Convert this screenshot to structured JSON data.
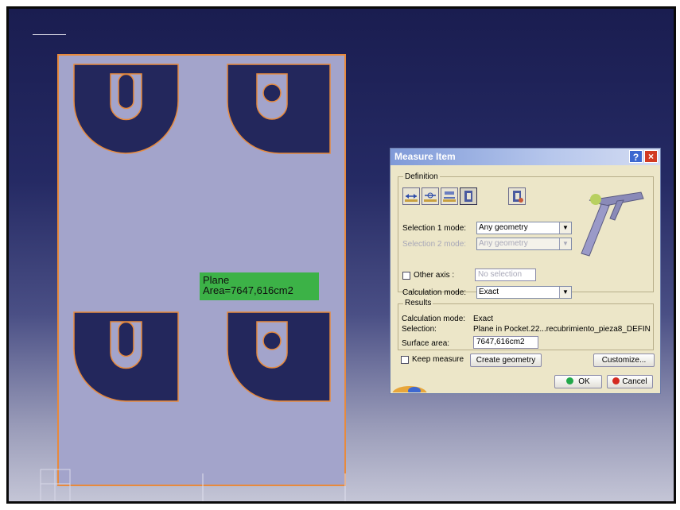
{
  "viewport": {
    "tooltip": {
      "line1": "Plane",
      "line2": "Area=7647,616cm2"
    }
  },
  "dialog": {
    "title": "Measure Item",
    "help_label": "?",
    "close_label": "×",
    "definition": {
      "group_label": "Definition",
      "tools": [
        "measure-between-icon",
        "measure-item-icon",
        "measure-thickness-icon",
        "measure-item-active-icon",
        "measure-inertia-icon"
      ],
      "selection1_label": "Selection 1 mode:",
      "selection1_value": "Any geometry",
      "selection2_label": "Selection 2 mode:",
      "selection2_value": "Any geometry",
      "other_axis_label": "Other axis :",
      "other_axis_value": "No selection",
      "calc_mode_label": "Calculation mode:",
      "calc_mode_value": "Exact"
    },
    "results": {
      "group_label": "Results",
      "calc_mode_label": "Calculation mode:",
      "calc_mode_value": "Exact",
      "selection_label": "Selection:",
      "selection_value": "Plane in Pocket.22...recubrimiento_pieza8_DEFIN",
      "surface_area_label": "Surface area:",
      "surface_area_value": "7647,616cm2"
    },
    "keep_measure_label": "Keep measure",
    "create_geometry_label": "Create geometry",
    "customize_label": "Customize...",
    "ok_label": "OK",
    "cancel_label": "Cancel"
  },
  "colors": {
    "plate_fill": "#a3a4cb",
    "plate_outline": "#e88a3c",
    "tooltip_bg": "#3cb247",
    "dialog_bg": "#ece6c8"
  }
}
